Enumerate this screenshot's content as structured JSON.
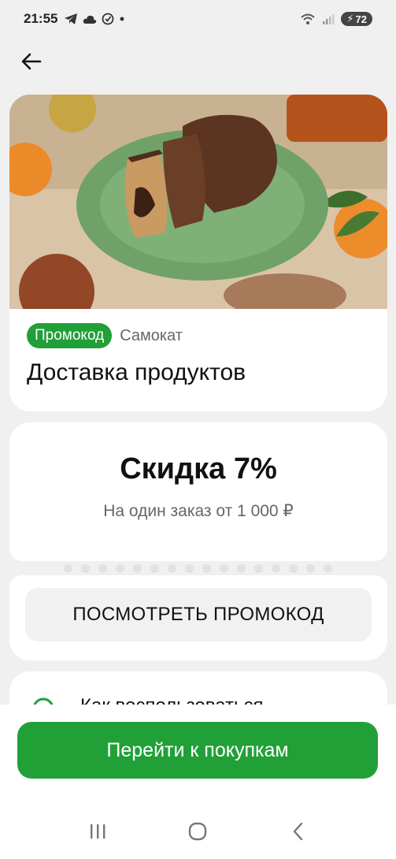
{
  "status_bar": {
    "time": "21:55",
    "battery": "72"
  },
  "icons": {
    "back": "arrow-left-icon",
    "telegram": "telegram-icon",
    "cloud": "cloud-icon",
    "check": "check-circle-icon",
    "wifi": "wifi-icon",
    "signal": "signal-icon",
    "battery": "battery-icon",
    "info": "info-icon",
    "nav_recent": "recent-apps-icon",
    "nav_home": "home-icon",
    "nav_back": "nav-back-icon"
  },
  "hero": {
    "badge": "Промокод",
    "brand": "Самокат",
    "title": "Доставка продуктов"
  },
  "discount": {
    "title": "Скидка 7%",
    "subtitle": "На один заказ от 1 000 ₽"
  },
  "code": {
    "button_label": "ПОСМОТРЕТЬ ПРОМОКОД"
  },
  "howto": {
    "label": "Как воспользоваться"
  },
  "cta": {
    "label": "Перейти к покупкам"
  },
  "colors": {
    "accent": "#21a038",
    "background": "#f0f0f0",
    "card": "#ffffff"
  }
}
